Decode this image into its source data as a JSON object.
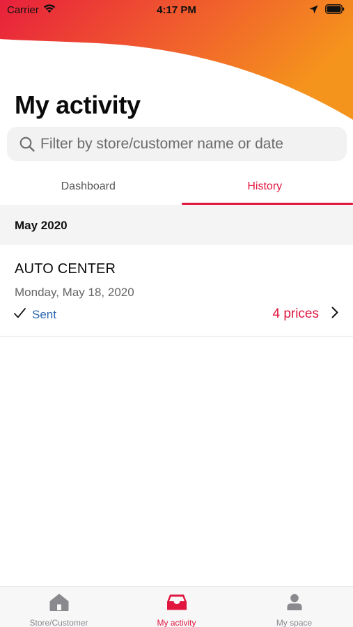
{
  "status_bar": {
    "carrier": "Carrier",
    "time": "4:17 PM"
  },
  "colors": {
    "accent": "#e0163f",
    "link": "#2b67b1",
    "gradient_start": "#e8203c",
    "gradient_end": "#f5941c"
  },
  "header": {
    "title": "My activity"
  },
  "search": {
    "placeholder": "Filter by store/customer name or date",
    "value": ""
  },
  "tabs": [
    {
      "label": "Dashboard",
      "active": false
    },
    {
      "label": "History",
      "active": true
    }
  ],
  "history": {
    "sections": [
      {
        "title": "May 2020",
        "items": [
          {
            "store": "AUTO CENTER",
            "date": "Monday, May 18, 2020",
            "status": "Sent",
            "prices": "4 prices"
          }
        ]
      }
    ]
  },
  "tab_bar": {
    "items": [
      {
        "label": "Store/Customer",
        "icon": "home-icon",
        "active": false
      },
      {
        "label": "My activity",
        "icon": "inbox-tray-icon",
        "active": true
      },
      {
        "label": "My space",
        "icon": "person-icon",
        "active": false
      }
    ]
  }
}
